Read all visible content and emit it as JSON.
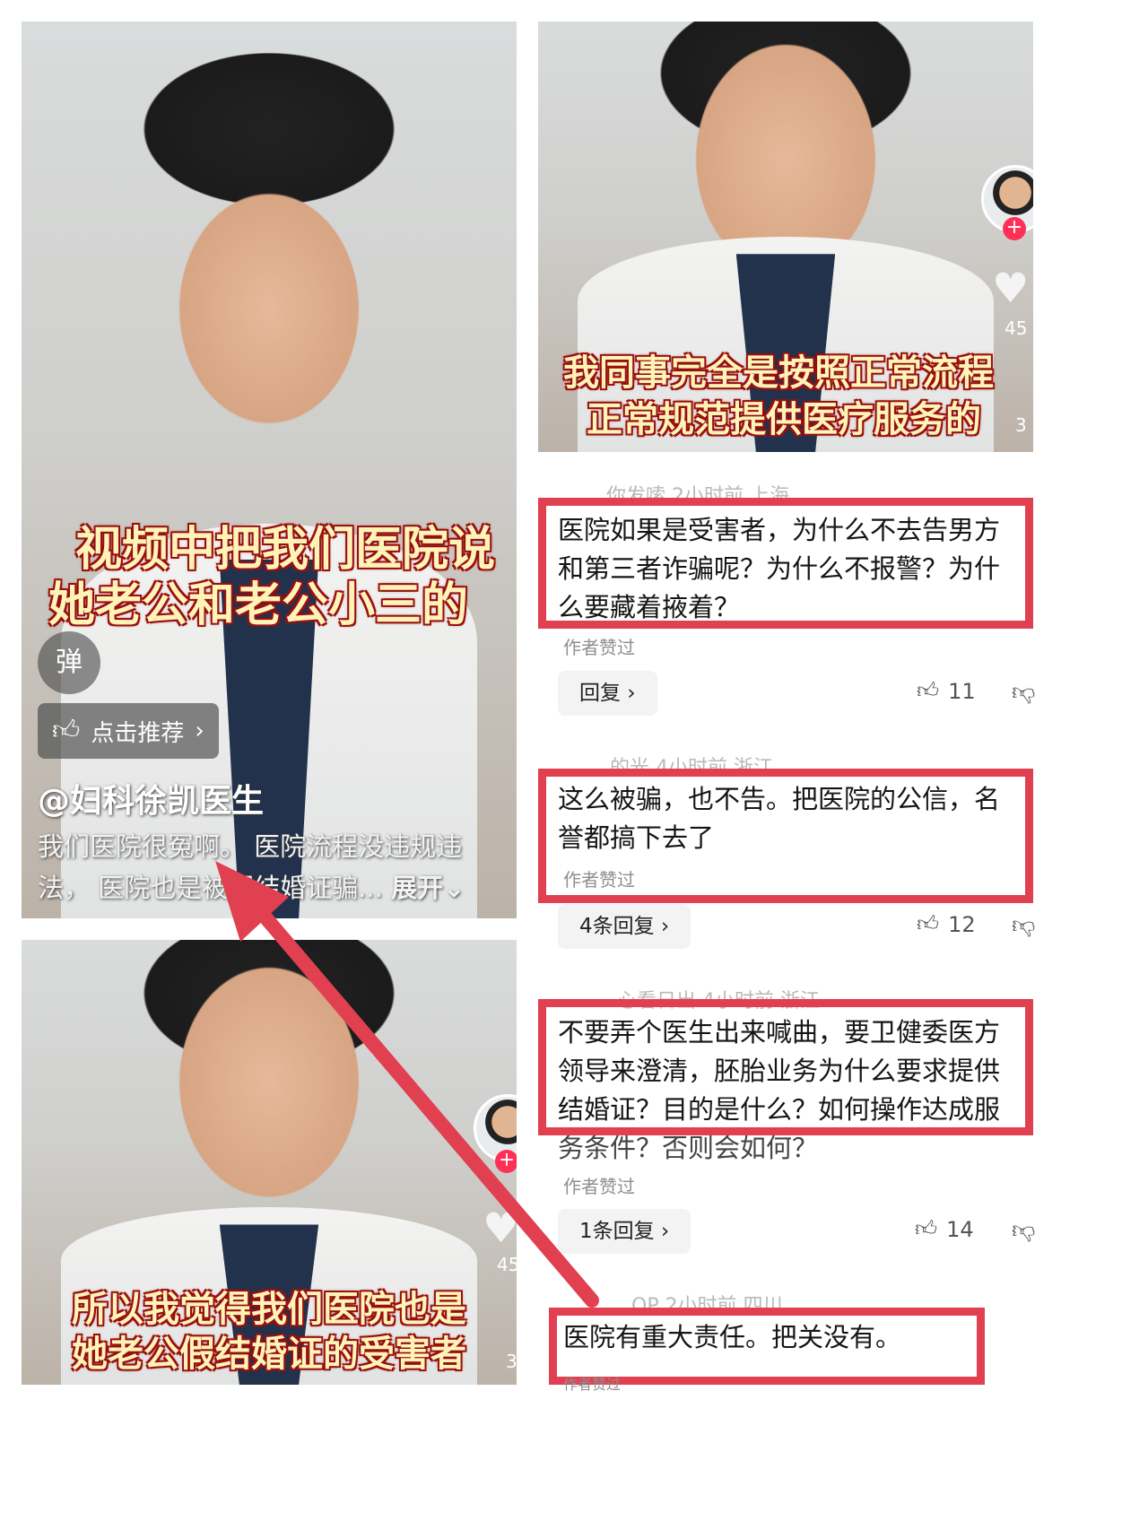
{
  "left_video": {
    "caption_lines": [
      "视频中把我们医院说",
      "她老公和老公小三的"
    ],
    "danmu_button": "弹",
    "recommend_label": "点击推荐",
    "username": "@妇科徐凯医生",
    "description_line1": "我们医院很冤啊。 医院流程没违规违",
    "description_line2": "法， 医院也是被假结婚证骗...",
    "expand_label": "展开"
  },
  "right_video": {
    "caption_lines": [
      "我同事完全是按照正常流程",
      "正常规范提供医疗服务的"
    ],
    "like_count": "45",
    "comment_count": "3"
  },
  "bottom_video": {
    "caption_lines": [
      "所以我觉得我们医院也是",
      "她老公假结婚证的受害者"
    ],
    "like_count": "45",
    "comment_count": "3"
  },
  "comments": [
    {
      "meta": "你发嗦 2小时前 上海",
      "text_lines": [
        "医院如果是受害者，为什么不去告男方",
        "和第三者诈骗呢？为什么不报警？为什",
        "么要藏着掖着？"
      ],
      "author_liked": "作者赞过",
      "reply_label": "回复",
      "likes": "11"
    },
    {
      "meta": "的光 4小时前 浙江",
      "text_lines": [
        "这么被骗，也不告。把医院的公信，名",
        "誉都搞下去了"
      ],
      "author_liked": "作者赞过",
      "reply_label": "4条回复",
      "likes": "12"
    },
    {
      "meta": "心看日出 4小时前 浙江",
      "text_lines": [
        "不要弄个医生出来喊曲，要卫健委医方",
        "领导来澄清，胚胎业务为什么要求提供",
        "结婚证？目的是什么？如何操作达成服",
        "务条件？否则会如何？"
      ],
      "author_liked": "作者赞过",
      "reply_label": "1条回复",
      "likes": "14"
    },
    {
      "meta": "QP 2小时前 四川",
      "text_lines": [
        "医院有重大责任。把关没有。"
      ],
      "author_liked": "作者赞过"
    }
  ],
  "colors": {
    "highlight_red": "#e0404f",
    "arrow_red": "#e0404f",
    "caption_fill": "#fff3b8",
    "caption_outline": "#a01010"
  }
}
